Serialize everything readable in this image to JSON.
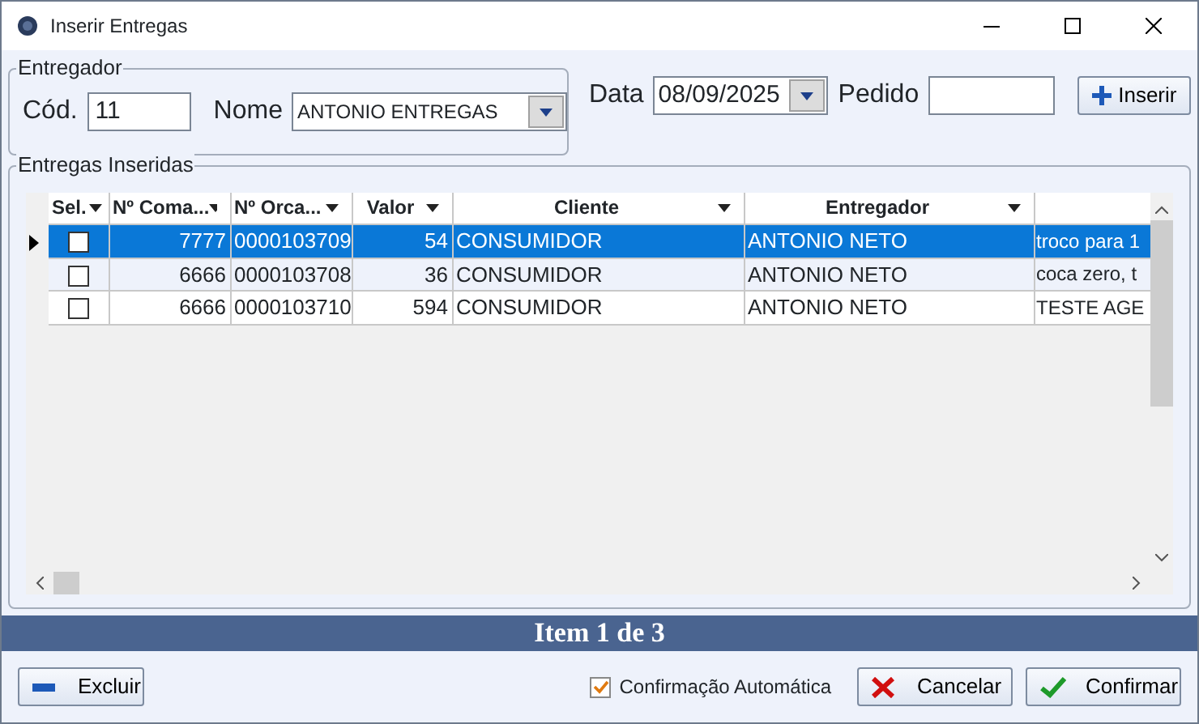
{
  "window": {
    "title": "Inserir Entregas"
  },
  "entregador": {
    "legend": "Entregador",
    "cod_label": "Cód.",
    "cod_value": "11",
    "nome_label": "Nome",
    "nome_value": "ANTONIO ENTREGAS"
  },
  "data": {
    "label": "Data",
    "value": "08/09/2025"
  },
  "pedido": {
    "label": "Pedido"
  },
  "insert_button": {
    "label": "Inserir"
  },
  "grid": {
    "legend": "Entregas Inseridas",
    "select_header": "Sel.",
    "columns": [
      "Nº Coma...",
      "Nº Orca...",
      "Valor",
      "Cliente",
      "Entregador"
    ],
    "rows": [
      {
        "selected": true,
        "current": true,
        "checked": false,
        "cells": [
          "7777",
          "0000103709",
          "54",
          "CONSUMIDOR",
          "ANTONIO NETO",
          "troco para 1"
        ]
      },
      {
        "selected": false,
        "current": false,
        "checked": false,
        "cells": [
          "6666",
          "0000103708",
          "36",
          "CONSUMIDOR",
          "ANTONIO NETO",
          "coca zero, t"
        ]
      },
      {
        "selected": false,
        "current": false,
        "checked": false,
        "cells": [
          "6666",
          "0000103710",
          "594",
          "CONSUMIDOR",
          "ANTONIO NETO",
          "TESTE AGE"
        ]
      }
    ]
  },
  "status_bar": "Item 1 de 3",
  "footer": {
    "delete_button": "Excluir",
    "auto_confirm": {
      "label": "Confirmação Automática",
      "checked": true
    },
    "cancel_button": "Cancelar",
    "confirm_button": "Confirmar"
  }
}
